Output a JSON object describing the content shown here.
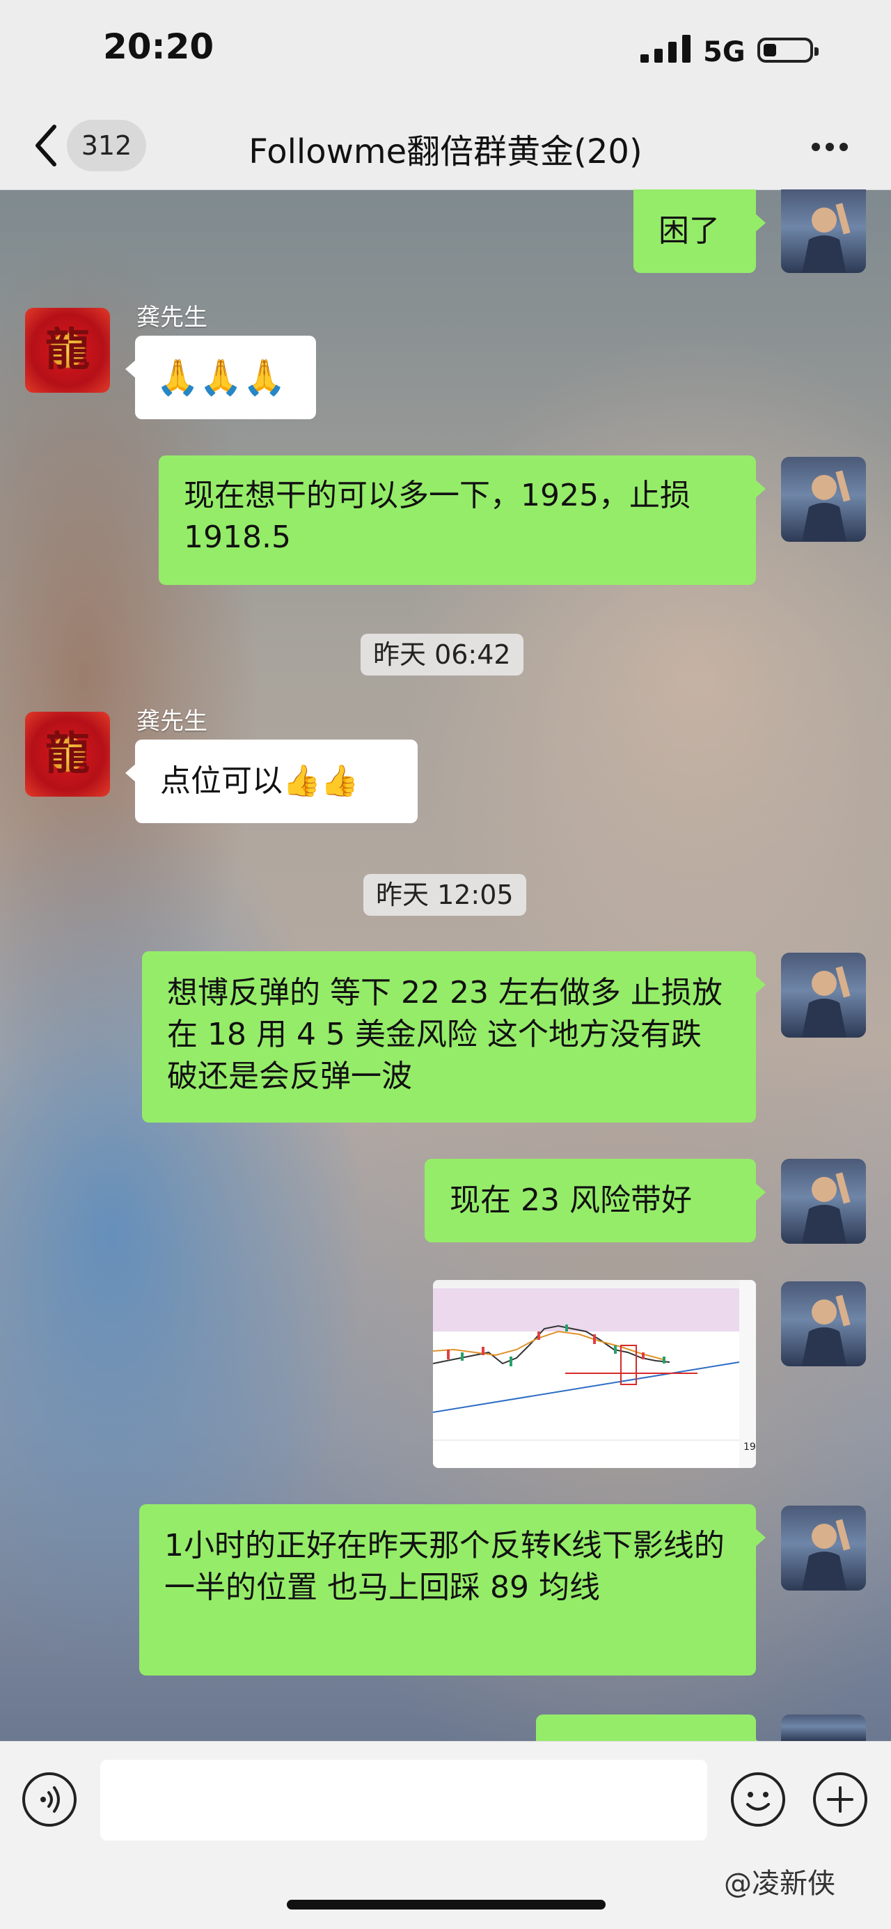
{
  "status": {
    "time": "20:20",
    "network": "5G"
  },
  "nav": {
    "back_count": "312",
    "title": "Followme翻倍群黄金(20)"
  },
  "sender": {
    "name": "龚先生",
    "avatar_char": "龍"
  },
  "messages": {
    "m1": "困了",
    "m2_emoji": [
      "🙏",
      "🙏",
      "🙏"
    ],
    "m3": "现在想干的可以多一下，1925，止损 1918.5",
    "ts1": "昨天 06:42",
    "m4_text": "点位可以",
    "m4_emoji": [
      "👍",
      "👍"
    ],
    "ts2": "昨天 12:05",
    "m5": "想博反弹的 等下 22 23 左右做多 止损放在 18  用 4 5 美金风险 这个地方没有跌破还是会反弹一波",
    "m6": "现在 23  风险带好",
    "m8": "1小时的正好在昨天那个反转K线下影线的一半的位置 也马上回踩 89 均线"
  },
  "watermark": "@凌新侠",
  "colors": {
    "my_bubble": "#95ec69",
    "their_bubble": "#ffffff",
    "bar": "#ededed"
  },
  "icons": [
    "chevron-left-icon",
    "more-icon",
    "voice-icon",
    "emoji-icon",
    "plus-icon",
    "signal-icon",
    "battery-icon"
  ]
}
